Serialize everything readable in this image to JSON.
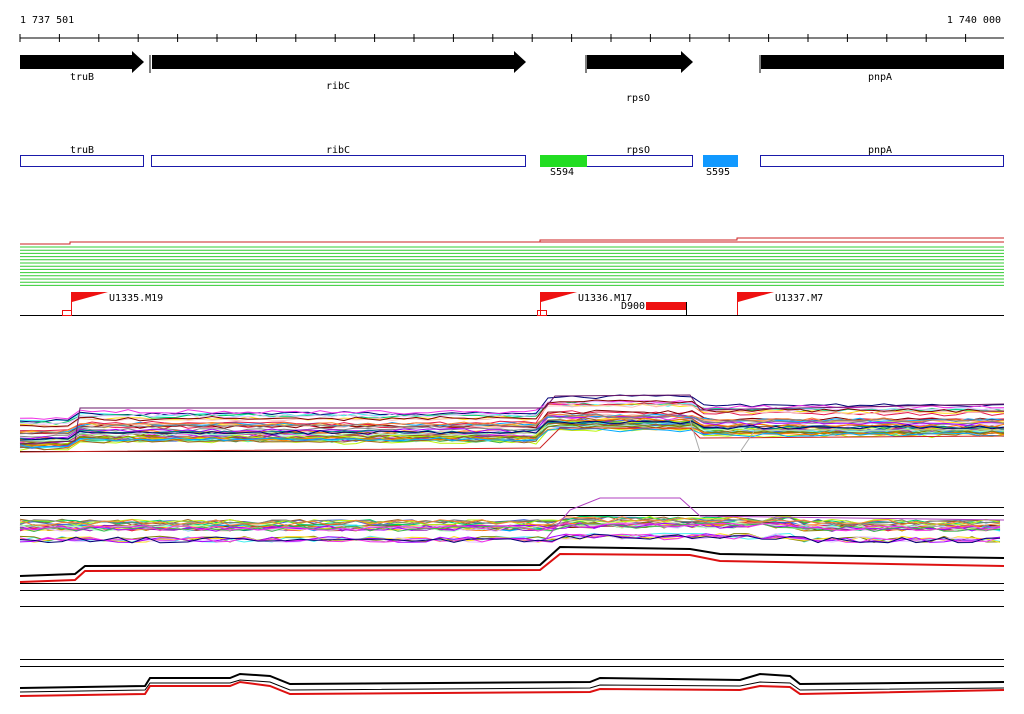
{
  "coordinates": {
    "start_label": "1 737 501",
    "end_label": "1 740 000"
  },
  "genes": [
    {
      "label": "truB",
      "strand": "+"
    },
    {
      "label": "ribC",
      "strand": "+"
    },
    {
      "label": "rpsO",
      "strand": "+"
    },
    {
      "label": "pnpA",
      "strand": "-"
    }
  ],
  "cds_boxes": [
    {
      "label": "truB"
    },
    {
      "label": "ribC"
    },
    {
      "label": "rpsO"
    },
    {
      "label": "pnpA"
    }
  ],
  "features": [
    {
      "label": "S594",
      "color": "#22dd22"
    },
    {
      "label": "S595",
      "color": "#1199ff"
    }
  ],
  "flags": [
    {
      "label": "U1335.M19"
    },
    {
      "label": "U1336.M17"
    },
    {
      "label": "U1337.M7"
    }
  ],
  "deletion": {
    "label": "D900",
    "color": "#ee1111"
  },
  "colors": {
    "gene_arrow": "#000000",
    "cds_outline": "#1a1aaa",
    "tiling_red": "#cc2222",
    "tiling_green": "#33cc33",
    "flag": "#ee1111"
  }
}
